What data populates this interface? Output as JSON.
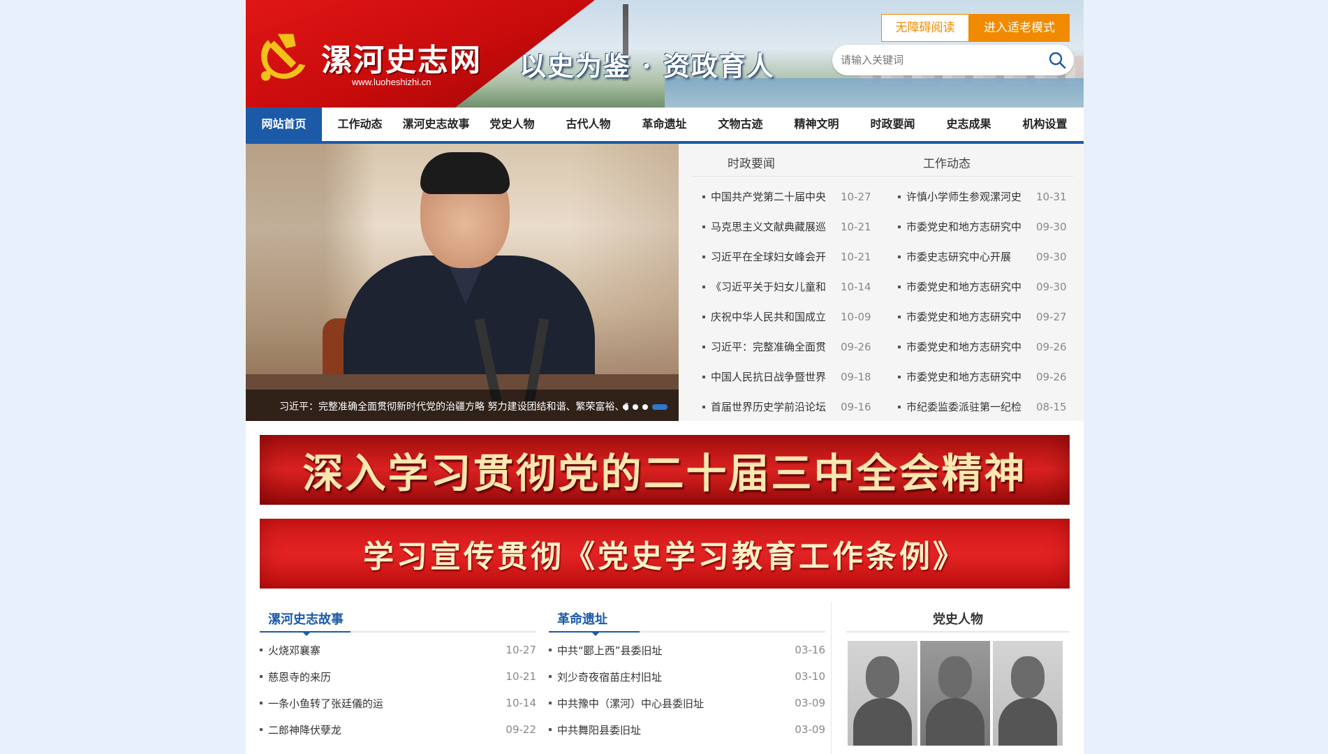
{
  "header": {
    "site_title": "漯河史志网",
    "site_url": "www.luoheshizhi.cn",
    "slogan": "以史为鉴 · 资政育人",
    "accessibility_button": "无障碍阅读",
    "elder_mode_button": "进入适老模式",
    "search_placeholder": "请输入关键词"
  },
  "nav": [
    {
      "label": "网站首页",
      "active": true
    },
    {
      "label": "工作动态"
    },
    {
      "label": "漯河史志故事"
    },
    {
      "label": "党史人物"
    },
    {
      "label": "古代人物"
    },
    {
      "label": "革命遗址"
    },
    {
      "label": "文物古迹"
    },
    {
      "label": "精神文明"
    },
    {
      "label": "时政要闻"
    },
    {
      "label": "史志成果"
    },
    {
      "label": "机构设置"
    }
  ],
  "banner": {
    "caption": "习近平：完整准确全面贯彻新时代党的治疆方略 努力建设团结和谐、繁荣富裕、文明..."
  },
  "news": {
    "tab1": "时政要闻",
    "tab2": "工作动态",
    "col1": [
      {
        "title": "中国共产党第二十届中央",
        "date": "10-27"
      },
      {
        "title": "马克思主义文献典藏展巡",
        "date": "10-21"
      },
      {
        "title": "习近平在全球妇女峰会开",
        "date": "10-21"
      },
      {
        "title": "《习近平关于妇女儿童和",
        "date": "10-14"
      },
      {
        "title": "庆祝中华人民共和国成立",
        "date": "10-09"
      },
      {
        "title": "习近平：完整准确全面贯",
        "date": "09-26"
      },
      {
        "title": "中国人民抗日战争暨世界",
        "date": "09-18"
      },
      {
        "title": "首届世界历史学前沿论坛",
        "date": "09-16"
      }
    ],
    "col2": [
      {
        "title": "许慎小学师生参观漯河史",
        "date": "10-31"
      },
      {
        "title": "市委党史和地方志研究中",
        "date": "09-30"
      },
      {
        "title": "市委史志研究中心开展",
        "date": "09-30"
      },
      {
        "title": "市委党史和地方志研究中",
        "date": "09-30"
      },
      {
        "title": "市委党史和地方志研究中",
        "date": "09-27"
      },
      {
        "title": "市委党史和地方志研究中",
        "date": "09-26"
      },
      {
        "title": "市委党史和地方志研究中",
        "date": "09-26"
      },
      {
        "title": "市纪委监委派驻第一纪检",
        "date": "08-15"
      }
    ]
  },
  "promos": {
    "promo1": "深入学习贯彻党的二十届三中全会精神",
    "promo2": "学习宣传贯彻《党史学习教育工作条例》"
  },
  "sections": {
    "stories": {
      "title": "漯河史志故事",
      "items": [
        {
          "title": "火烧邓襄寨",
          "date": "10-27"
        },
        {
          "title": "慈恩寺的来历",
          "date": "10-21"
        },
        {
          "title": "一条小鱼转了张廷儀的运",
          "date": "10-14"
        },
        {
          "title": "二郎神降伏孽龙",
          "date": "09-22"
        }
      ]
    },
    "sites": {
      "title": "革命遗址",
      "items": [
        {
          "title": "中共“郾上西”县委旧址",
          "date": "03-16"
        },
        {
          "title": "刘少奇夜宿苗庄村旧址",
          "date": "03-10"
        },
        {
          "title": "中共豫中（漯河）中心县委旧址",
          "date": "03-09"
        },
        {
          "title": "中共舞阳县委旧址",
          "date": "03-09"
        }
      ]
    },
    "figures": {
      "title": "党史人物"
    }
  },
  "colors": {
    "brand_blue": "#1c5aa8",
    "accent_orange": "#f08a00",
    "party_red": "#d41818"
  },
  "icons": {
    "emblem": "party-emblem-icon",
    "search": "search-icon"
  }
}
